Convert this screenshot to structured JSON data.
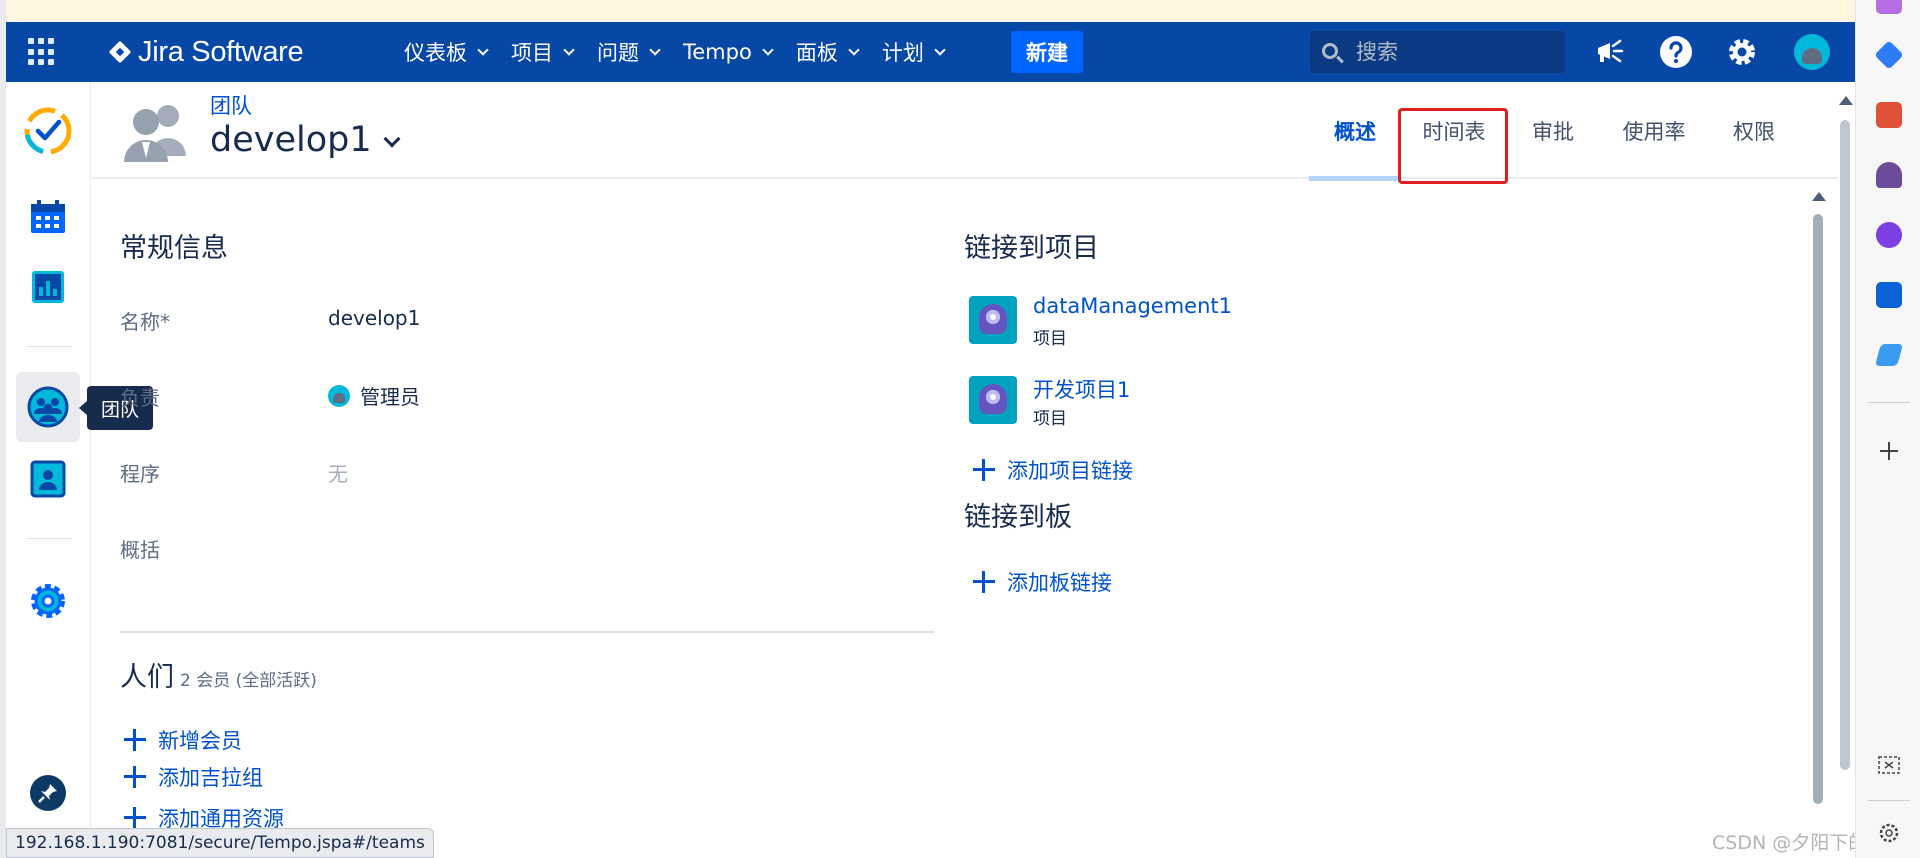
{
  "topnav": {
    "logo_text": "Jira Software",
    "menus": [
      {
        "label": "仪表板"
      },
      {
        "label": "项目"
      },
      {
        "label": "问题"
      },
      {
        "label": "Tempo"
      },
      {
        "label": "面板"
      },
      {
        "label": "计划"
      }
    ],
    "create_label": "新建",
    "search_placeholder": "搜索",
    "icons": [
      "apps-grid-icon",
      "megaphone-icon",
      "help-icon",
      "settings-gear-icon",
      "user-avatar"
    ]
  },
  "sidebar": {
    "icons": [
      "tempo-logo-icon",
      "calendar-icon",
      "reports-chart-icon",
      "teams-icon",
      "user-card-icon",
      "gear-icon",
      "pin-icon"
    ],
    "active_item": "teams-icon",
    "tooltip": "团队"
  },
  "header": {
    "breadcrumb": "团队",
    "team_name": "develop1",
    "tabs": [
      {
        "label": "概述",
        "active": true
      },
      {
        "label": "时间表",
        "active": false,
        "highlighted": true
      },
      {
        "label": "审批",
        "active": false
      },
      {
        "label": "使用率",
        "active": false
      },
      {
        "label": "权限",
        "active": false
      }
    ]
  },
  "general": {
    "title": "常规信息",
    "fields": [
      {
        "label": "名称*",
        "value": "develop1"
      },
      {
        "label": "负责",
        "value": "管理员"
      },
      {
        "label": "程序",
        "value": "无"
      },
      {
        "label": "概括",
        "value": ""
      }
    ]
  },
  "people": {
    "title": "人们",
    "meta": "2 会员 (全部活跃)",
    "actions": [
      "新增会员",
      "添加吉拉组",
      "添加通用资源"
    ]
  },
  "linked_projects": {
    "title": "链接到项目",
    "items": [
      {
        "name": "dataManagement1",
        "type": "项目"
      },
      {
        "name": "开发项目1",
        "type": "项目"
      }
    ],
    "add_label": "添加项目链接"
  },
  "linked_boards": {
    "title": "链接到板",
    "add_label": "添加板链接"
  },
  "statusbar": {
    "url": "192.168.1.190:7081/secure/Tempo.jspa#/teams"
  },
  "watermark": "CSDN @夕阳下的孤帆",
  "colors": {
    "nav": "#0747a6",
    "create": "#0065ff",
    "link": "#0052cc",
    "highlight": "#e02020"
  }
}
